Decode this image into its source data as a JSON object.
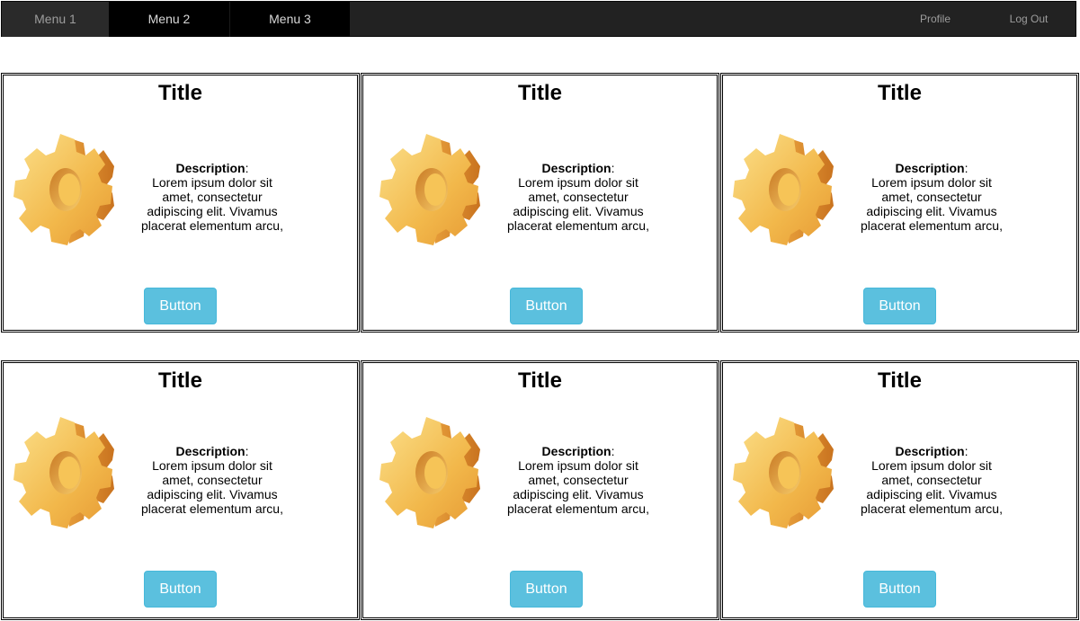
{
  "navbar": {
    "left_items": [
      {
        "label": "Menu 1"
      },
      {
        "label": "Menu 2"
      },
      {
        "label": "Menu 3"
      }
    ],
    "right_items": [
      {
        "label": "Profile"
      },
      {
        "label": "Log Out"
      }
    ],
    "colors": {
      "bar": "#222222",
      "active": "#000000",
      "text": "#9d9d9d"
    }
  },
  "cards": [
    {
      "title": "Title",
      "icon": "gear-icon",
      "desc_label": "Description",
      "desc_text": "Lorem ipsum dolor sit amet, consectetur adipiscing elit. Vivamus placerat elementum arcu,",
      "button": "Button"
    },
    {
      "title": "Title",
      "icon": "gear-icon",
      "desc_label": "Description",
      "desc_text": "Lorem ipsum dolor sit amet, consectetur adipiscing elit. Vivamus placerat elementum arcu,",
      "button": "Button"
    },
    {
      "title": "Title",
      "icon": "gear-icon",
      "desc_label": "Description",
      "desc_text": "Lorem ipsum dolor sit amet, consectetur adipiscing elit. Vivamus placerat elementum arcu,",
      "button": "Button"
    },
    {
      "title": "Title",
      "icon": "gear-icon",
      "desc_label": "Description",
      "desc_text": "Lorem ipsum dolor sit amet, consectetur adipiscing elit. Vivamus placerat elementum arcu,",
      "button": "Button"
    },
    {
      "title": "Title",
      "icon": "gear-icon",
      "desc_label": "Description",
      "desc_text": "Lorem ipsum dolor sit amet, consectetur adipiscing elit. Vivamus placerat elementum arcu,",
      "button": "Button"
    },
    {
      "title": "Title",
      "icon": "gear-icon",
      "desc_label": "Description",
      "desc_text": "Lorem ipsum dolor sit amet, consectetur adipiscing elit. Vivamus placerat elementum arcu,",
      "button": "Button"
    }
  ],
  "theme": {
    "button_color": "#5bc0de",
    "gear_light": "#f7c95c",
    "gear_dark": "#d9822b"
  }
}
